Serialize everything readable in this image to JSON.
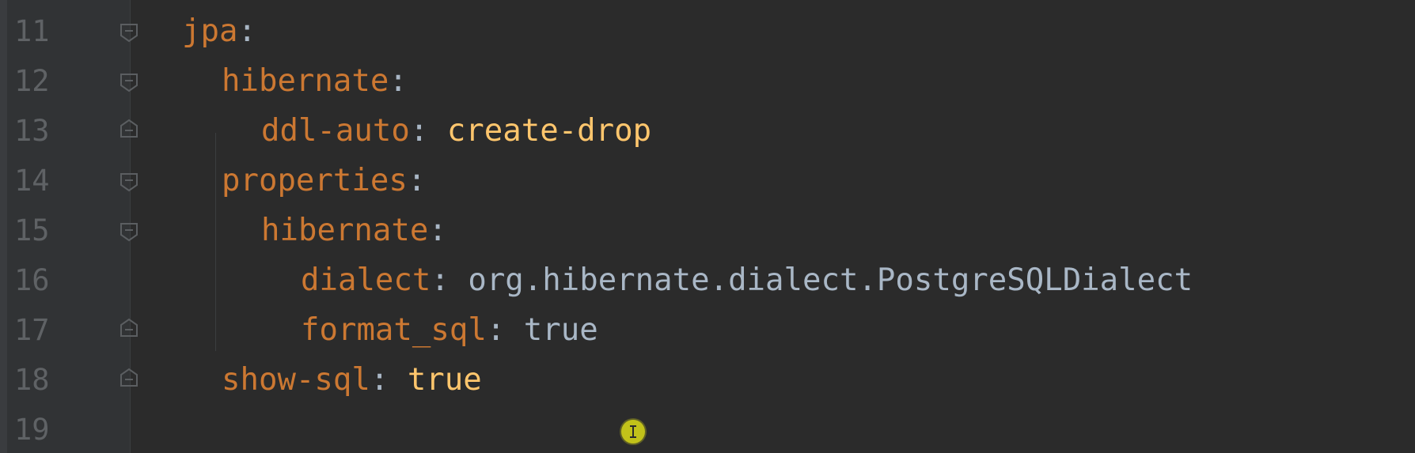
{
  "editor": {
    "lines": [
      {
        "num": "11",
        "key": "jpa",
        "colon": ":",
        "value": "",
        "value_type": "none"
      },
      {
        "num": "12",
        "key": "hibernate",
        "colon": ":",
        "value": "",
        "value_type": "none"
      },
      {
        "num": "13",
        "key": "ddl-auto",
        "colon": ":",
        "value": "create-drop",
        "value_type": "string"
      },
      {
        "num": "14",
        "key": "properties",
        "colon": ":",
        "value": "",
        "value_type": "none"
      },
      {
        "num": "15",
        "key": "hibernate",
        "colon": ":",
        "value": "",
        "value_type": "none"
      },
      {
        "num": "16",
        "key": "dialect",
        "colon": ":",
        "value": "org.hibernate.dialect.PostgreSQLDialect",
        "value_type": "plain"
      },
      {
        "num": "17",
        "key": "format_sql",
        "colon": ":",
        "value": "true",
        "value_type": "plain"
      },
      {
        "num": "18",
        "key": "show-sql",
        "colon": ":",
        "value": "true",
        "value_type": "string"
      },
      {
        "num": "19",
        "key": "",
        "colon": "",
        "value": "",
        "value_type": "none"
      }
    ]
  },
  "colors": {
    "background": "#2b2b2b",
    "gutter": "#313335",
    "line_number": "#5f6265",
    "yaml_key": "#cc7832",
    "yaml_string_value": "#ffc66d",
    "yaml_plain_value": "#a9b7c6",
    "cursor_highlight": "#c2c21a"
  },
  "icons": {
    "fold_open": "fold-open-icon",
    "fold_end": "fold-end-icon",
    "text_cursor": "text-cursor-icon"
  }
}
